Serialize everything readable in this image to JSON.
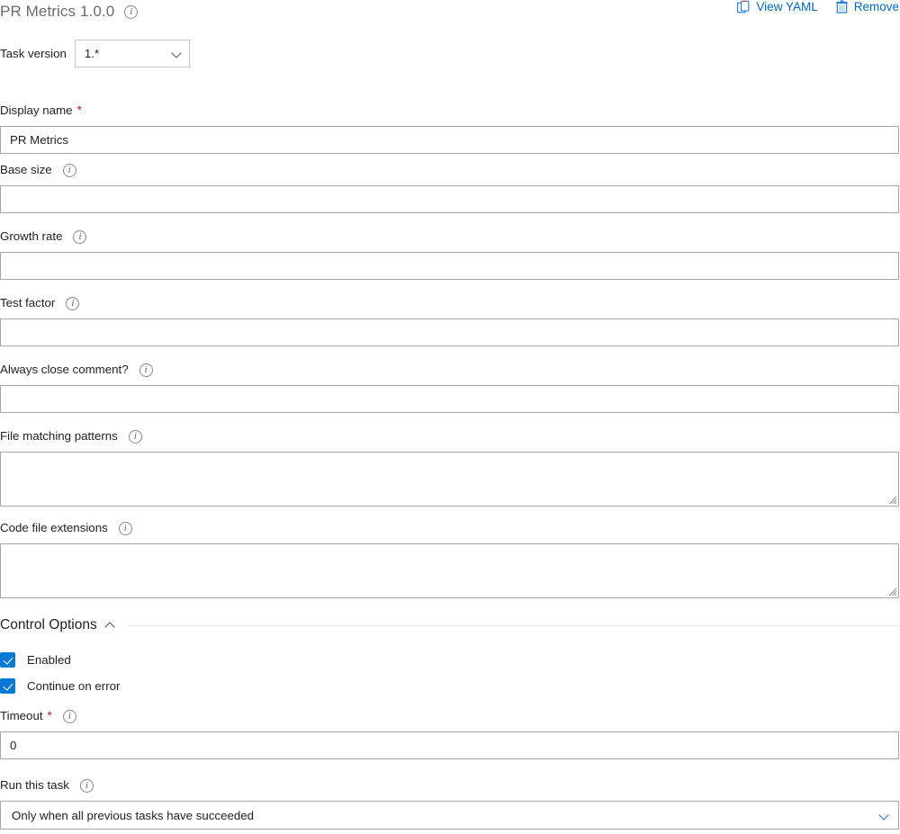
{
  "header": {
    "title": "PR Metrics 1.0.0",
    "info_icon": "info-icon",
    "actions": [
      {
        "label": "View YAML",
        "icon": "clipboard-icon"
      },
      {
        "label": "Remove",
        "icon": "trash-icon"
      }
    ]
  },
  "task_version": {
    "label": "Task version",
    "value": "1.*",
    "chevron": "chevron-down-icon"
  },
  "fields": [
    {
      "label": "Display name",
      "required": true,
      "info": false,
      "value": "PR Metrics",
      "placeholder": "",
      "type": "input"
    },
    {
      "label": "Base size",
      "required": false,
      "info": true,
      "value": "",
      "placeholder": "",
      "type": "input"
    },
    {
      "label": "Growth rate",
      "required": false,
      "info": true,
      "value": "",
      "placeholder": "",
      "type": "input"
    },
    {
      "label": "Test factor",
      "required": false,
      "info": true,
      "value": "",
      "placeholder": "",
      "type": "input"
    },
    {
      "label": "Always close comment?",
      "required": false,
      "info": true,
      "value": "",
      "placeholder": "",
      "type": "input"
    },
    {
      "label": "File matching patterns",
      "required": false,
      "info": true,
      "value": "",
      "placeholder": "",
      "type": "textarea"
    },
    {
      "label": "Code file extensions",
      "required": false,
      "info": true,
      "value": "",
      "placeholder": "",
      "type": "textarea"
    }
  ],
  "control_options": {
    "title": "Control Options",
    "collapse_icon": "chevron-up-icon",
    "checkboxes": [
      {
        "label": "Enabled",
        "checked": true
      },
      {
        "label": "Continue on error",
        "checked": true
      }
    ],
    "timeout": {
      "label": "Timeout",
      "required": true,
      "value": "0",
      "info": true
    },
    "run_this_task": {
      "label": "Run this task",
      "info": true,
      "value": "Only when all previous tasks have succeeded",
      "chevron": "chevron-down-icon"
    }
  },
  "colors": {
    "accent": "#0078d4",
    "link": "#0068b8",
    "required": "#a4262c",
    "border": "#a8a7a6",
    "title": "#6b6b6b"
  }
}
